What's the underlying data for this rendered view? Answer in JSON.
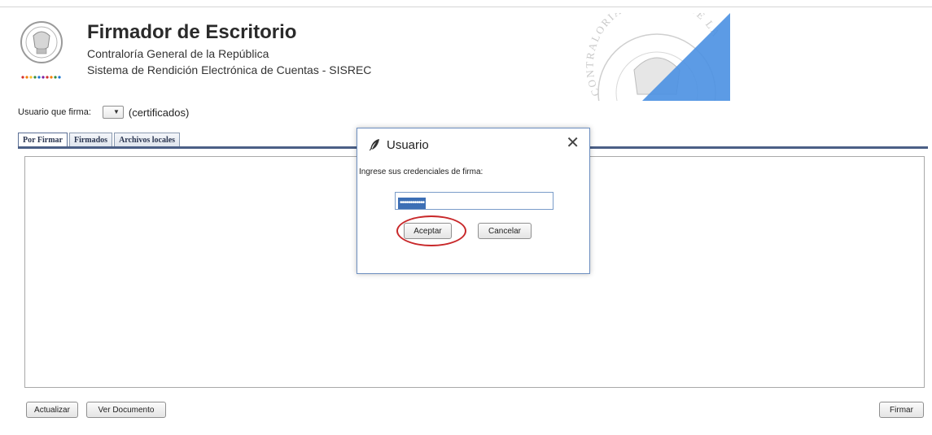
{
  "header": {
    "title": "Firmador de Escritorio",
    "subtitle": "Contraloría General de la República",
    "system_name": "Sistema de Rendición Electrónica de Cuentas - SISREC",
    "seal_icon": "contraloria-seal-icon",
    "watermark_text": "CONTRALORIA GENERAL DE LA REPUBLICA"
  },
  "user_row": {
    "label": "Usuario que firma:",
    "selected_value": "",
    "suffix": "(certificados)"
  },
  "tabs": [
    {
      "label": "Por Firmar",
      "active": true
    },
    {
      "label": "Firmados",
      "active": false
    },
    {
      "label": "Archivos locales",
      "active": false
    }
  ],
  "buttons": {
    "actualizar": "Actualizar",
    "ver_documento": "Ver Documento",
    "firmar": "Firmar"
  },
  "dialog": {
    "title": "Usuario",
    "title_icon": "feather-icon",
    "close_icon": "close-icon",
    "prompt": "Ingrese sus credenciales de firma:",
    "password_value": "••••••••••••",
    "accept_label": "Aceptar",
    "cancel_label": "Cancelar"
  },
  "colors": {
    "tab_line": "#4b5f86",
    "dialog_border": "#6d8fc0",
    "highlight": "#c8282a",
    "password_selection": "#3d6fb5",
    "watermark_blue": "#4a90e2"
  }
}
